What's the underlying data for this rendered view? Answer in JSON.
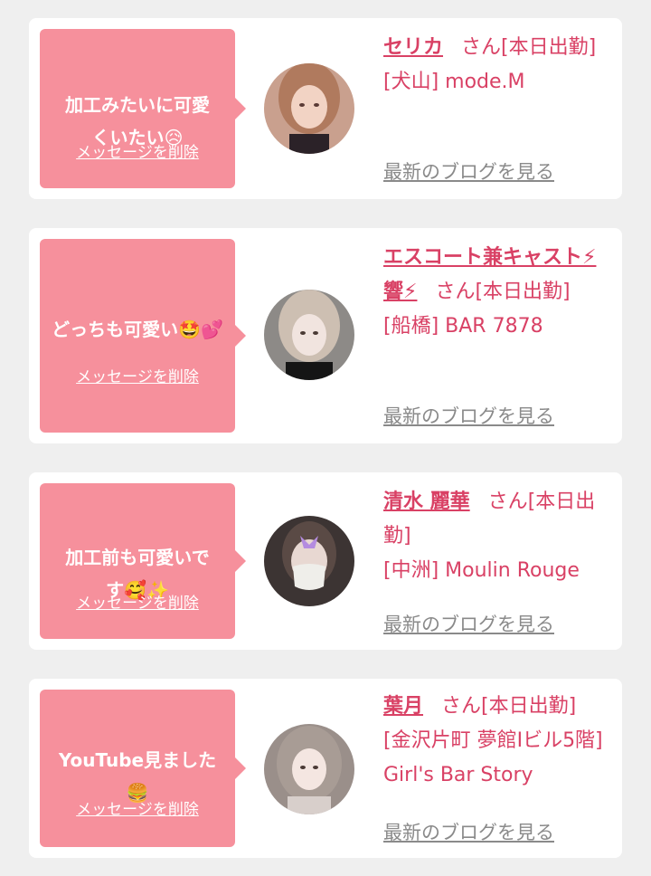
{
  "delete_label": "メッセージを削除",
  "blog_label": "最新のブログを見る",
  "san_label": "さん",
  "status_label": "[本日出勤]",
  "colors": {
    "background": "#efefef",
    "bubble": "#f6909c",
    "accent": "#d94165",
    "muted": "#8a8a8a"
  },
  "entries": [
    {
      "message": "加工みたいに可愛\nくいたい",
      "message_emoji": "😥",
      "name": "セリカ",
      "shop": "[犬山] mode.M",
      "avatar": "avatar-photo-1"
    },
    {
      "message": "どっちも可愛い",
      "message_emoji": "🤩💕",
      "name": "エスコート兼キャスト⚡響⚡",
      "shop": "[船橋] BAR 7878",
      "avatar": "avatar-photo-2"
    },
    {
      "message": "加工前も可愛いで\nす",
      "message_emoji": "🥰✨",
      "name": "清水 麗華",
      "shop": "[中洲] Moulin Rouge",
      "avatar": "avatar-photo-3"
    },
    {
      "message": "YouTube見ました",
      "message_emoji": "🍔",
      "name": "葉月",
      "shop": "[金沢片町 夢館Ⅰビル5階] Girl's Bar Story",
      "avatar": "avatar-photo-4"
    }
  ]
}
